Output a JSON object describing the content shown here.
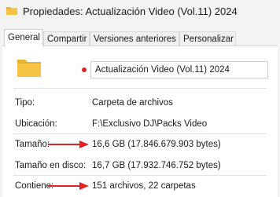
{
  "window": {
    "title": "Propiedades: Actualización Video (Vol.11) 2024"
  },
  "tabs": [
    {
      "label": "General"
    },
    {
      "label": "Compartir"
    },
    {
      "label": "Versiones anteriores"
    },
    {
      "label": "Personalizar"
    }
  ],
  "general": {
    "folder_name": "Actualización Video (Vol.11) 2024",
    "rows": [
      {
        "label": "Tipo:",
        "value": "Carpeta de archivos"
      },
      {
        "label": "Ubicación:",
        "value": "F:\\Exclusivo DJ\\Packs Video"
      },
      {
        "label": "Tamaño:",
        "value": "16,6 GB (17.846.679.903 bytes)"
      },
      {
        "label": "Tamaño en disco:",
        "value": "16,7 GB (17.932.746.752 bytes)"
      },
      {
        "label": "Contiene:",
        "value": "151 archivos, 22 carpetas"
      }
    ]
  },
  "colors": {
    "folder": "#f6c443",
    "annotation_red": "#e02424",
    "window_bg": "#f3f3f3"
  },
  "icons": {
    "title": "folder-icon",
    "main": "folder-icon",
    "marker": "red-dot",
    "annotation": "red-arrow"
  }
}
